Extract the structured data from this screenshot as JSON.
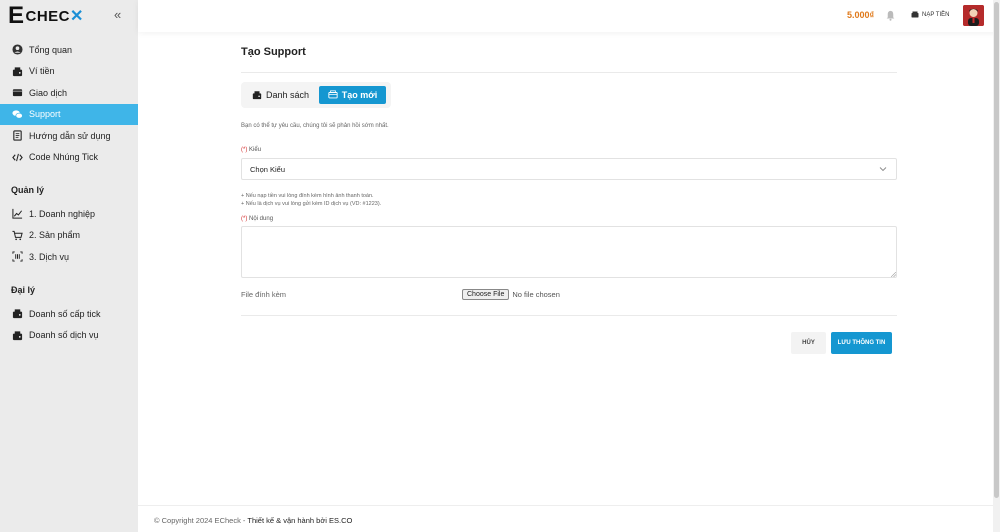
{
  "brand": {
    "logo_e": "E",
    "logo_text": "CHEC",
    "logo_x": "✕"
  },
  "sidebar": {
    "collapse_label": "«",
    "main_items": [
      {
        "label": "Tổng quan",
        "icon": "user-circle-icon"
      },
      {
        "label": "Ví tiền",
        "icon": "wallet-icon"
      },
      {
        "label": "Giao dịch",
        "icon": "card-icon"
      },
      {
        "label": "Support",
        "icon": "chat-icon",
        "active": true
      },
      {
        "label": "Hướng dẫn sử dụng",
        "icon": "book-icon"
      },
      {
        "label": "Code Nhúng Tick",
        "icon": "code-icon"
      }
    ],
    "section_manage": "Quản lý",
    "manage_items": [
      {
        "label": "1. Doanh nghiệp",
        "icon": "chart-icon"
      },
      {
        "label": "2. Sản phẩm",
        "icon": "cart-icon"
      },
      {
        "label": "3. Dịch vụ",
        "icon": "barcode-icon"
      }
    ],
    "section_agent": "Đại lý",
    "agent_items": [
      {
        "label": "Doanh số cấp tick",
        "icon": "wallet-icon"
      },
      {
        "label": "Doanh số dịch vụ",
        "icon": "wallet-icon"
      }
    ]
  },
  "header": {
    "balance": "5.000₫",
    "topup_label": "NẠP TIỀN"
  },
  "main": {
    "title": "Tạo Support",
    "tab_list": "Danh sách",
    "tab_new": "Tạo mới",
    "intro": "Bạn có thể tự yêu cầu, chúng tôi sẽ phản hồi sớm nhất.",
    "required_mark": "(*)",
    "type_label": "Kiểu",
    "type_value": "Chọn Kiểu",
    "hint_1": "+ Nếu nạp tiền vui lòng đính kèm hình ảnh thanh toán.",
    "hint_2": "+ Nếu là dịch vụ vui lòng gửi kèm ID dịch vụ (VD: #1223).",
    "content_label": "Nội dung",
    "attach_label": "File đính kèm",
    "choose_file": "Choose File",
    "no_file": "No file chosen",
    "cancel_label": "HỦY",
    "save_label": "LƯU THÔNG TIN"
  },
  "footer": {
    "copyright": "© Copyright 2024 ECheck - ",
    "credit": "Thiết kế & vận hành bởi ES.CO"
  },
  "colors": {
    "accent": "#1597d1",
    "sidebar_active": "#3fb5e8",
    "balance": "#e07a1b",
    "required": "#d32f2f"
  }
}
